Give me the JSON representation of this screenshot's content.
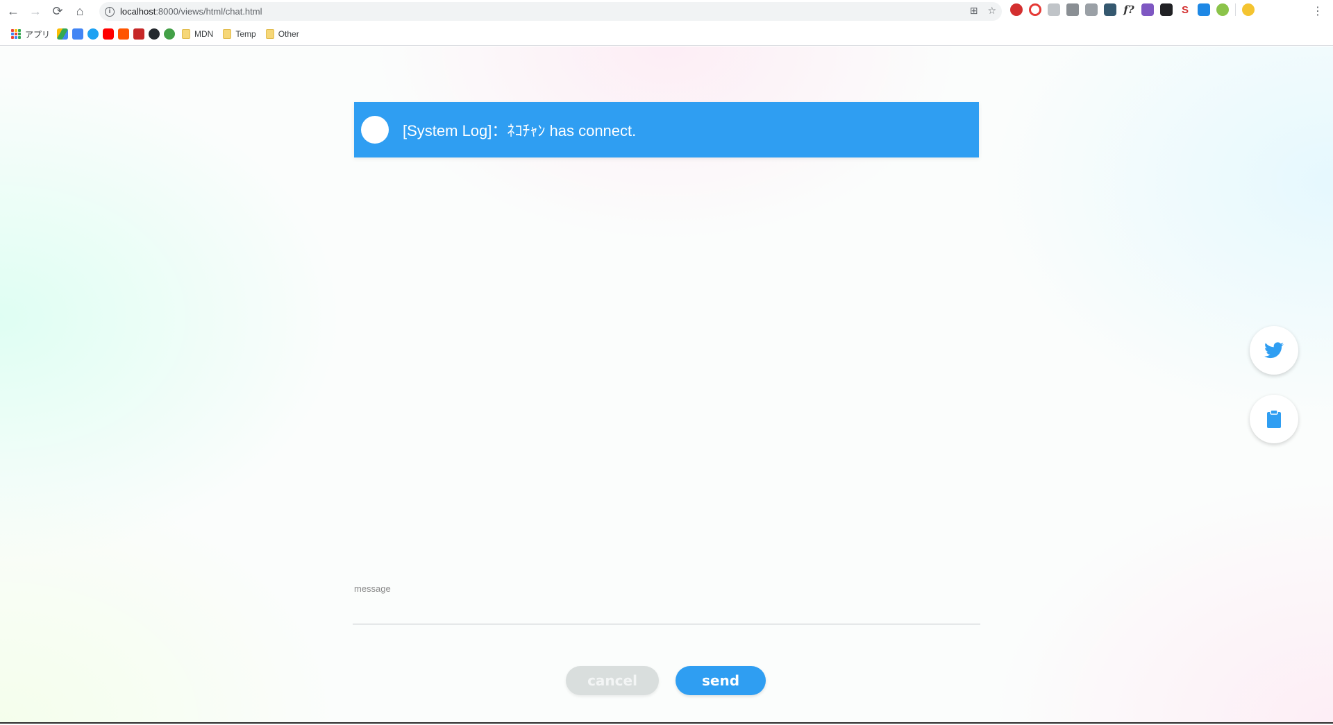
{
  "browser": {
    "url_host": "localhost",
    "url_path": ":8000/views/html/chat.html",
    "bookmarks": {
      "apps_label": "アプリ",
      "folders": [
        "MDN",
        "Temp",
        "Other"
      ]
    },
    "extension_icons": [
      "lastpass-icon",
      "opera-icon",
      "puzzle-icon",
      "camera-icon",
      "box-icon",
      "book-icon",
      "fx-icon",
      "pen-icon",
      "mask-icon",
      "s-icon",
      "translate-icon",
      "shield-icon"
    ]
  },
  "chat": {
    "log_message": "[System Log]：ﾈｺﾁｬﾝ has connect."
  },
  "composer": {
    "label": "message",
    "value": "",
    "placeholder": ""
  },
  "buttons": {
    "cancel": "cancel",
    "send": "send"
  },
  "colors": {
    "accent": "#2f9ef2",
    "cancel_bg": "#d9dedd"
  }
}
